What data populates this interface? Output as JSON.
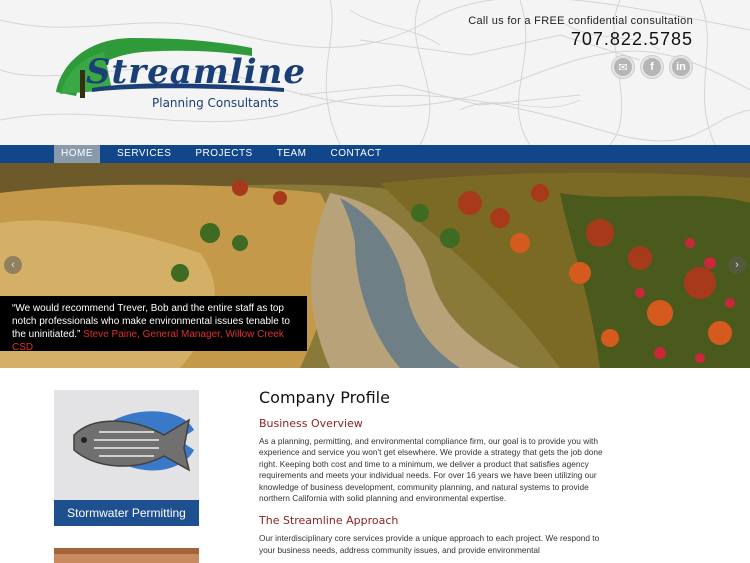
{
  "header": {
    "logo_title": "Streamline",
    "logo_subtitle": "Planning Consultants",
    "call_text": "Call us for a FREE confidential consultation",
    "phone": "707.822.5785",
    "social": [
      {
        "icon": "email-icon",
        "glyph": "✉"
      },
      {
        "icon": "facebook-icon",
        "glyph": "f"
      },
      {
        "icon": "linkedin-icon",
        "glyph": "in"
      }
    ]
  },
  "nav": {
    "items": [
      "HOME",
      "SERVICES",
      "PROJECTS",
      "TEAM",
      "CONTACT"
    ],
    "active": "HOME"
  },
  "hero": {
    "quote_text": "“We would recommend Trever, Bob and the entire staff as top notch professionals who make environmental issues tenable to the uninitiated.”",
    "quote_cite": "Steve Paine, General Manager, Willow Creek CSD",
    "arrow_left": "‹",
    "arrow_right": "›"
  },
  "sidebar": {
    "card_label": "Stormwater Permitting"
  },
  "main": {
    "title": "Company Profile",
    "section1_heading": "Business Overview",
    "section1_text": "As a planning, permitting, and environmental compliance firm, our goal is to provide you with experience and service you won't get elsewhere. We provide a strategy that gets the job done right. Keeping both cost and time to a minimum, we deliver a product that satisfies agency requirements and meets your individual needs. For over 16 years we have been utilizing our knowledge of business development, community planning, and natural systems to provide northern California with solid planning and environmental expertise.",
    "section2_heading": "The Streamline Approach",
    "section2_text": "Our interdisciplinary core services provide a unique approach to each project. We respond to your business needs, address community issues, and provide environmental"
  },
  "colors": {
    "nav_bg": "#12468a",
    "accent_red": "#8a2222",
    "card_blue": "#1e4f8f"
  }
}
